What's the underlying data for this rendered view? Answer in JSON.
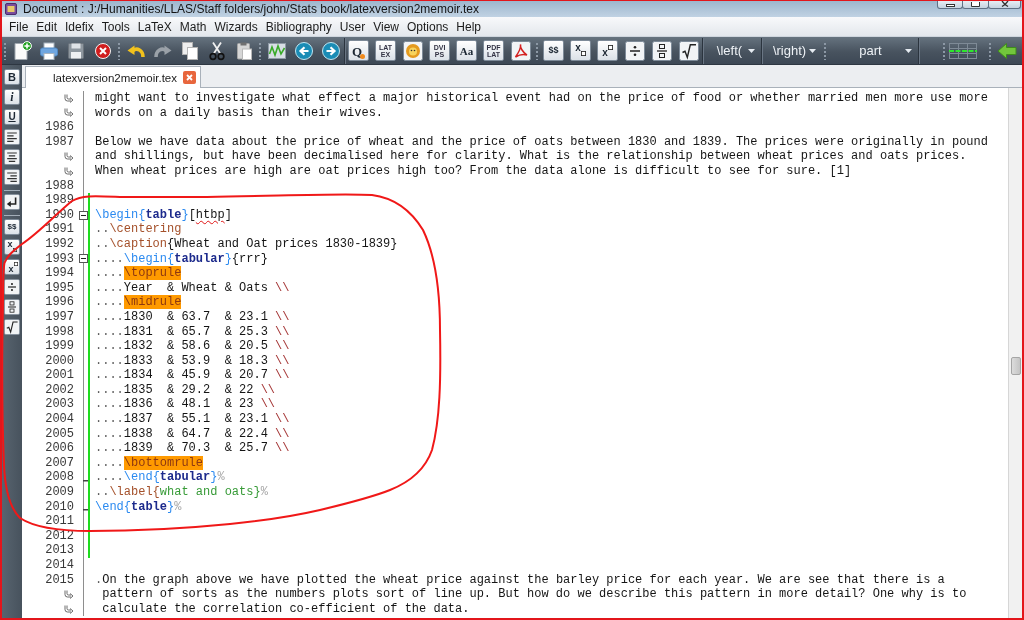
{
  "window": {
    "title": "Document : J:/Humanities/LLAS/Staff folders/john/Stats book/latexversion2memoir.tex"
  },
  "menu": [
    "File",
    "Edit",
    "Idefix",
    "Tools",
    "LaTeX",
    "Math",
    "Wizards",
    "Bibliography",
    "User",
    "View",
    "Options",
    "Help"
  ],
  "toolbar": {
    "tiles": [
      {
        "kind": "quick",
        "label": "Q"
      },
      {
        "kind": "stack",
        "lines": [
          "LAT",
          "EX"
        ]
      },
      {
        "kind": "stack",
        "lines": [
          "DVI",
          "PS"
        ]
      },
      {
        "kind": "serif",
        "label": "Aa"
      },
      {
        "kind": "stack",
        "lines": [
          "PDF",
          "LAT"
        ]
      },
      {
        "kind": "plain",
        "label": "$$"
      },
      {
        "kind": "subscript",
        "label": "x"
      },
      {
        "kind": "superscript",
        "label": "x"
      }
    ],
    "dropdowns": [
      "\\left(",
      "\\right)",
      "part"
    ]
  },
  "side_toolbar": [
    {
      "kind": "bold",
      "label": "B"
    },
    {
      "kind": "italic",
      "label": "i"
    },
    {
      "kind": "underline",
      "label": "U"
    },
    {
      "kind": "plain",
      "label": "$$"
    },
    {
      "kind": "subscript",
      "label": "x"
    },
    {
      "kind": "superscript",
      "label": "x"
    }
  ],
  "tabs": [
    {
      "label": "latexversion2memoir.tex",
      "selected": true
    }
  ],
  "editor": {
    "lines": [
      {
        "wrapped": [
          "might want to investigate what effect a major historical event had on the price of food or whether married men more use more",
          "words on a daily basis than their wives."
        ],
        "modified": false
      },
      {
        "number": "1986",
        "modified": false,
        "fold_start": false,
        "fold_end": false
      },
      {
        "number": "1987",
        "segments": [
          {
            "kind": "text",
            "text": "Below we have data about the price of wheat and the price of oats between 1830 and 1839. The prices were originally in pound"
          }
        ],
        "wrapped": [
          "and shillings, but have been decimalised here for clarity. What is the relationship between wheat prices and oats prices.",
          "When wheat prices are high are oat prices high too? From the data alone is difficult to see for sure. [1]"
        ],
        "modified": false,
        "fold_start": false,
        "fold_end": false
      },
      {
        "number": "1988",
        "modified": false,
        "fold_start": false,
        "fold_end": false
      },
      {
        "number": "1989",
        "modified": true,
        "fold_start": false,
        "fold_end": false
      },
      {
        "number": "1990",
        "modified": true,
        "fold_start": true,
        "fold_end": false,
        "segments": [
          {
            "kind": "begin",
            "text": "\\begin"
          },
          {
            "kind": "brace",
            "text": "{"
          },
          {
            "kind": "env",
            "text": "table"
          },
          {
            "kind": "brace",
            "text": "}"
          },
          {
            "kind": "text",
            "text": "["
          },
          {
            "kind": "misspelled",
            "text": "htbp"
          },
          {
            "kind": "text",
            "text": "]"
          }
        ]
      },
      {
        "number": "1991",
        "modified": true,
        "fold_start": false,
        "fold_end": false,
        "segments": [
          {
            "kind": "indent",
            "text": ".."
          },
          {
            "kind": "command",
            "text": "\\centering"
          }
        ]
      },
      {
        "number": "1992",
        "modified": true,
        "fold_start": false,
        "fold_end": false,
        "segments": [
          {
            "kind": "indent",
            "text": ".."
          },
          {
            "kind": "command",
            "text": "\\caption"
          },
          {
            "kind": "text",
            "text": "{Wheat and Oat prices 1830-1839}"
          }
        ]
      },
      {
        "number": "1993",
        "modified": true,
        "fold_start": true,
        "fold_end": false,
        "segments": [
          {
            "kind": "indent",
            "text": "...."
          },
          {
            "kind": "begin",
            "text": "\\begin"
          },
          {
            "kind": "brace",
            "text": "{"
          },
          {
            "kind": "env",
            "text": "tabular"
          },
          {
            "kind": "brace",
            "text": "}"
          },
          {
            "kind": "text",
            "text": "{rrr}"
          }
        ]
      },
      {
        "number": "1994",
        "modified": true,
        "fold_start": false,
        "fold_end": false,
        "segments": [
          {
            "kind": "indent",
            "text": "...."
          },
          {
            "kind": "highlight",
            "text": "\\toprule"
          }
        ]
      },
      {
        "number": "1995",
        "modified": true,
        "fold_start": false,
        "fold_end": false,
        "segments": [
          {
            "kind": "indent",
            "text": "...."
          },
          {
            "kind": "text",
            "text": "Year  & Wheat & Oats "
          },
          {
            "kind": "linebreak",
            "text": "\\\\"
          }
        ]
      },
      {
        "number": "1996",
        "modified": true,
        "fold_start": false,
        "fold_end": false,
        "segments": [
          {
            "kind": "indent",
            "text": "...."
          },
          {
            "kind": "highlight",
            "text": "\\midrule"
          }
        ]
      },
      {
        "number": "1997",
        "modified": true,
        "fold_start": false,
        "fold_end": false,
        "segments": [
          {
            "kind": "indent",
            "text": "...."
          },
          {
            "kind": "text",
            "text": "1830  & 63.7  & 23.1 "
          },
          {
            "kind": "linebreak",
            "text": "\\\\"
          }
        ]
      },
      {
        "number": "1998",
        "modified": true,
        "fold_start": false,
        "fold_end": false,
        "segments": [
          {
            "kind": "indent",
            "text": "...."
          },
          {
            "kind": "text",
            "text": "1831  & 65.7  & 25.3 "
          },
          {
            "kind": "linebreak",
            "text": "\\\\"
          }
        ]
      },
      {
        "number": "1999",
        "modified": true,
        "fold_start": false,
        "fold_end": false,
        "segments": [
          {
            "kind": "indent",
            "text": "...."
          },
          {
            "kind": "text",
            "text": "1832  & 58.6  & 20.5 "
          },
          {
            "kind": "linebreak",
            "text": "\\\\"
          }
        ]
      },
      {
        "number": "2000",
        "modified": true,
        "fold_start": false,
        "fold_end": false,
        "segments": [
          {
            "kind": "indent",
            "text": "...."
          },
          {
            "kind": "text",
            "text": "1833  & 53.9  & 18.3 "
          },
          {
            "kind": "linebreak",
            "text": "\\\\"
          }
        ]
      },
      {
        "number": "2001",
        "modified": true,
        "fold_start": false,
        "fold_end": false,
        "segments": [
          {
            "kind": "indent",
            "text": "...."
          },
          {
            "kind": "text",
            "text": "1834  & 45.9  & 20.7 "
          },
          {
            "kind": "linebreak",
            "text": "\\\\"
          }
        ]
      },
      {
        "number": "2002",
        "modified": true,
        "fold_start": false,
        "fold_end": false,
        "segments": [
          {
            "kind": "indent",
            "text": "...."
          },
          {
            "kind": "text",
            "text": "1835  & 29.2  & 22 "
          },
          {
            "kind": "linebreak",
            "text": "\\\\"
          }
        ]
      },
      {
        "number": "2003",
        "modified": true,
        "fold_start": false,
        "fold_end": false,
        "segments": [
          {
            "kind": "indent",
            "text": "...."
          },
          {
            "kind": "text",
            "text": "1836  & 48.1  & 23 "
          },
          {
            "kind": "linebreak",
            "text": "\\\\"
          }
        ]
      },
      {
        "number": "2004",
        "modified": true,
        "fold_start": false,
        "fold_end": false,
        "segments": [
          {
            "kind": "indent",
            "text": "...."
          },
          {
            "kind": "text",
            "text": "1837  & 55.1  & 23.1 "
          },
          {
            "kind": "linebreak",
            "text": "\\\\"
          }
        ]
      },
      {
        "number": "2005",
        "modified": true,
        "fold_start": false,
        "fold_end": false,
        "segments": [
          {
            "kind": "indent",
            "text": "...."
          },
          {
            "kind": "text",
            "text": "1838  & 64.7  & 22.4 "
          },
          {
            "kind": "linebreak",
            "text": "\\\\"
          }
        ]
      },
      {
        "number": "2006",
        "modified": true,
        "fold_start": false,
        "fold_end": false,
        "segments": [
          {
            "kind": "indent",
            "text": "...."
          },
          {
            "kind": "text",
            "text": "1839  & 70.3  & 25.7 "
          },
          {
            "kind": "linebreak",
            "text": "\\\\"
          }
        ]
      },
      {
        "number": "2007",
        "modified": true,
        "fold_start": false,
        "fold_end": false,
        "segments": [
          {
            "kind": "indent",
            "text": "...."
          },
          {
            "kind": "highlight",
            "text": "\\bottomrule"
          }
        ]
      },
      {
        "number": "2008",
        "modified": true,
        "fold_start": false,
        "fold_end": true,
        "segments": [
          {
            "kind": "indent",
            "text": "...."
          },
          {
            "kind": "begin",
            "text": "\\end"
          },
          {
            "kind": "brace",
            "text": "{"
          },
          {
            "kind": "env",
            "text": "tabular"
          },
          {
            "kind": "brace",
            "text": "}"
          },
          {
            "kind": "comment",
            "text": "%"
          }
        ]
      },
      {
        "number": "2009",
        "modified": true,
        "fold_start": false,
        "fold_end": false,
        "segments": [
          {
            "kind": "indent",
            "text": ".."
          },
          {
            "kind": "command",
            "text": "\\label{"
          },
          {
            "kind": "label",
            "text": "what and oats}"
          },
          {
            "kind": "comment",
            "text": "%"
          }
        ]
      },
      {
        "number": "2010",
        "modified": true,
        "fold_start": false,
        "fold_end": true,
        "segments": [
          {
            "kind": "begin",
            "text": "\\end"
          },
          {
            "kind": "brace",
            "text": "{"
          },
          {
            "kind": "env",
            "text": "table"
          },
          {
            "kind": "brace",
            "text": "}"
          },
          {
            "kind": "comment",
            "text": "%"
          }
        ]
      },
      {
        "number": "2011",
        "modified": true,
        "fold_start": false,
        "fold_end": false
      },
      {
        "number": "2012",
        "modified": true,
        "fold_start": false,
        "fold_end": false
      },
      {
        "number": "2013",
        "modified": true,
        "fold_start": false,
        "fold_end": false
      },
      {
        "number": "2014",
        "modified": false,
        "fold_start": false,
        "fold_end": false
      },
      {
        "number": "2015",
        "modified": false,
        "fold_start": false,
        "fold_end": false,
        "segments": [
          {
            "kind": "indent",
            "text": "."
          },
          {
            "kind": "text",
            "text": "On the graph above we have plotted the wheat price against the barley price for each year. We are see that there is a"
          }
        ],
        "wrapped": [
          "pattern of sorts as the numbers plots sort of line up. But how do we describe this pattern in more detail? One why is to",
          "calculate the correlation co-efficient of the data."
        ]
      }
    ]
  }
}
